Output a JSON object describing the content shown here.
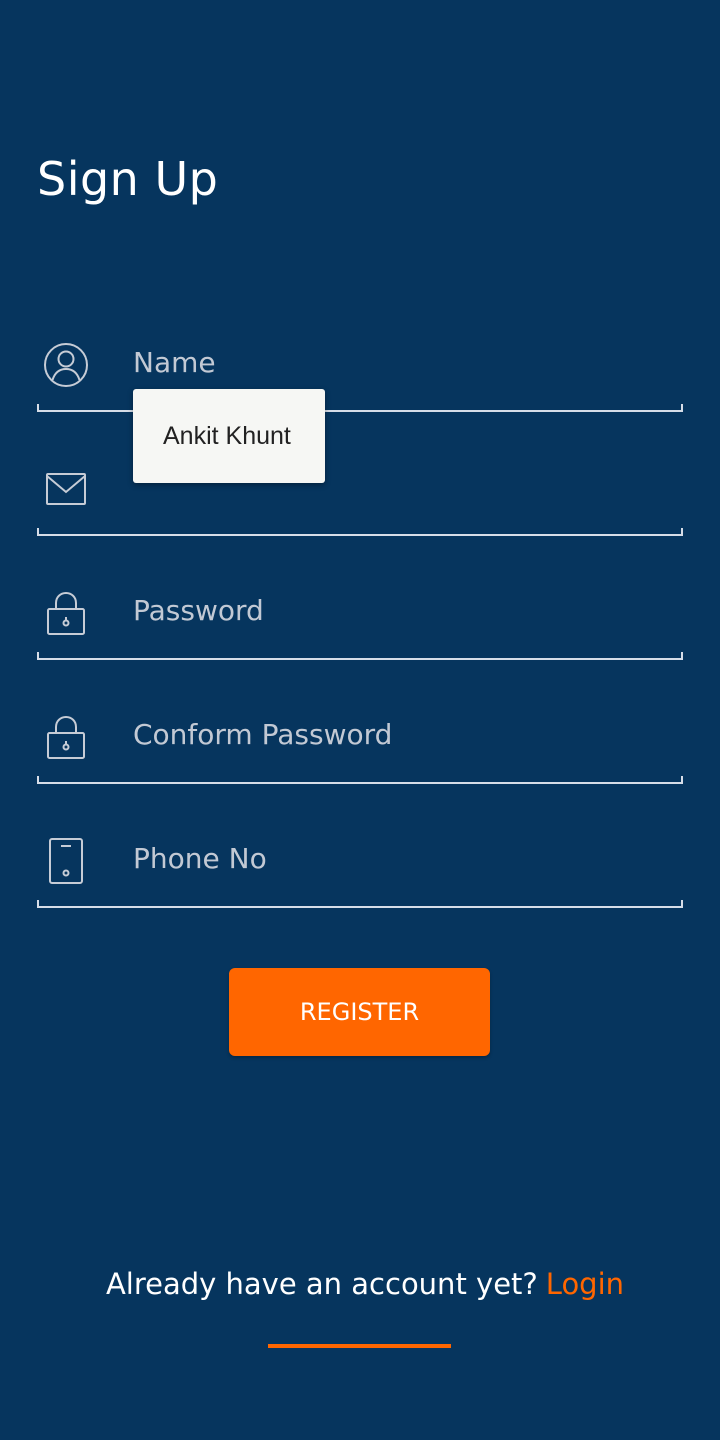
{
  "header": {
    "title": "Sign Up"
  },
  "form": {
    "name": {
      "placeholder": "Name",
      "icon": "user-circle-icon"
    },
    "email": {
      "placeholder": "",
      "icon": "envelope-icon"
    },
    "password": {
      "placeholder": "Password",
      "icon": "lock-icon"
    },
    "confirm_password": {
      "placeholder": "Conform Password",
      "icon": "lock-icon"
    },
    "phone": {
      "placeholder": "Phone No",
      "icon": "phone-icon"
    }
  },
  "autofill": {
    "suggestion": "Ankit Khunt"
  },
  "actions": {
    "register_label": "REGISTER"
  },
  "footer": {
    "prompt": "Already have an account yet?",
    "login_label": "Login"
  },
  "colors": {
    "background": "#06355e",
    "accent": "#ff6600",
    "field_text": "#c2c9d4",
    "line": "#d6dde8"
  }
}
